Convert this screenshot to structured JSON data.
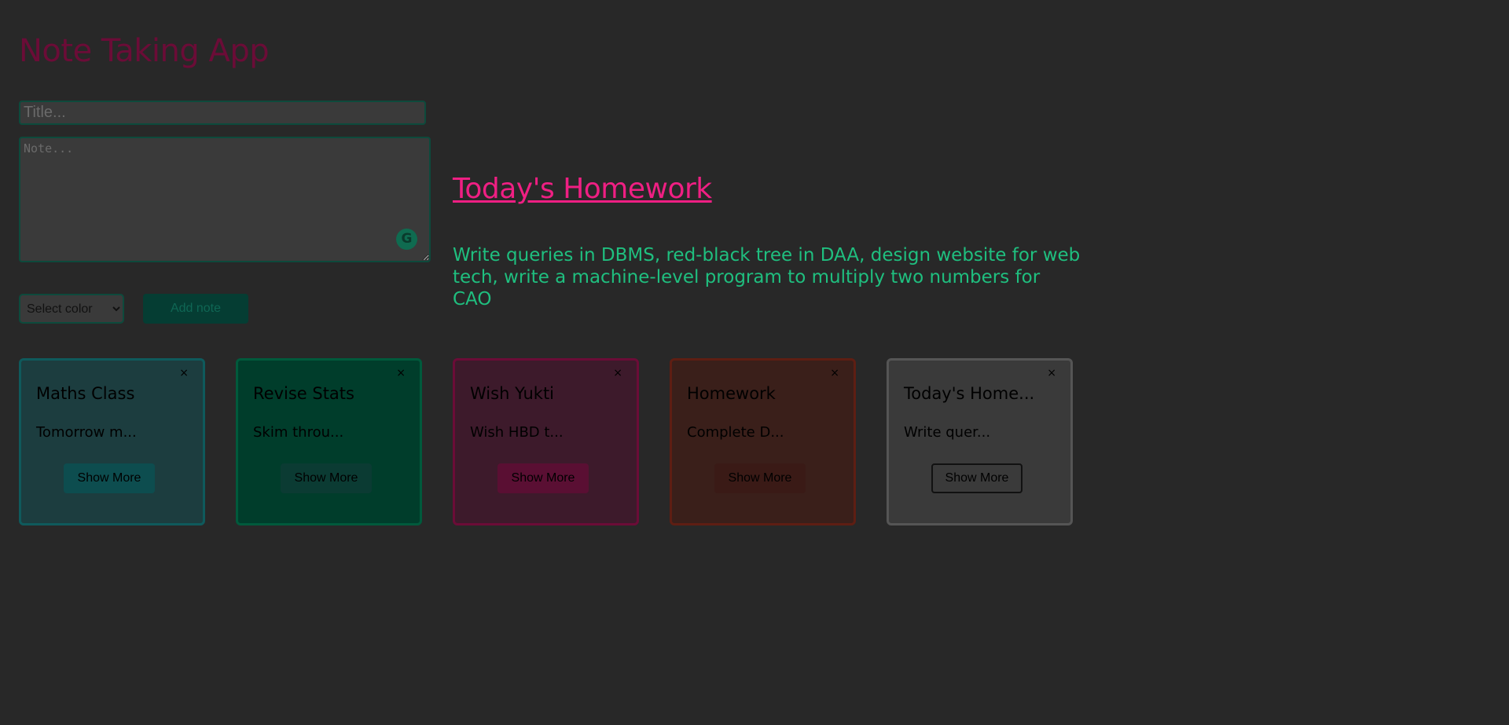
{
  "app": {
    "title": "Note Taking App"
  },
  "form": {
    "title_placeholder": "Title...",
    "title_value": "",
    "note_placeholder": "Note...",
    "note_value": "",
    "grammarly_glyph": "G",
    "color_select": {
      "selected": "Select color",
      "options": [
        "Select color"
      ]
    },
    "add_label": "Add note"
  },
  "preview": {
    "title": "Today's Homework",
    "body": "Write queries in DBMS, red-black tree in DAA, design website for web tech, write a machine-level program to multiply two numbers for CAO"
  },
  "notes": [
    {
      "title": "Maths Class",
      "excerpt": "Tomorrow m...",
      "close": "×",
      "button": "Show More",
      "colors": {
        "bg": "#1c3d3f",
        "border": "#0f5a5c",
        "button": "#0d4d4f"
      }
    },
    {
      "title": "Revise Stats",
      "excerpt": "Skim throu...",
      "close": "×",
      "button": "Show More",
      "colors": {
        "bg": "#003d2b",
        "border": "#005a3c",
        "button": "#0b3b33"
      }
    },
    {
      "title": "Wish Yukti",
      "excerpt": "Wish HBD t...",
      "close": "×",
      "button": "Show More",
      "colors": {
        "bg": "#3d1a2b",
        "border": "#6b0c37",
        "button": "#5a0f33"
      }
    },
    {
      "title": "Homework",
      "excerpt": "Complete D...",
      "close": "×",
      "button": "Show More",
      "colors": {
        "bg": "#3a1f1a",
        "border": "#5e1e13",
        "button": "#3a1a16"
      }
    },
    {
      "title": "Today's Home...",
      "excerpt": "Write quer...",
      "close": "×",
      "button": "Show More",
      "colors": {
        "bg": "#3a3a3a",
        "border": "#555555",
        "button": "#3a3a3a",
        "button_border": "#111111"
      }
    }
  ]
}
